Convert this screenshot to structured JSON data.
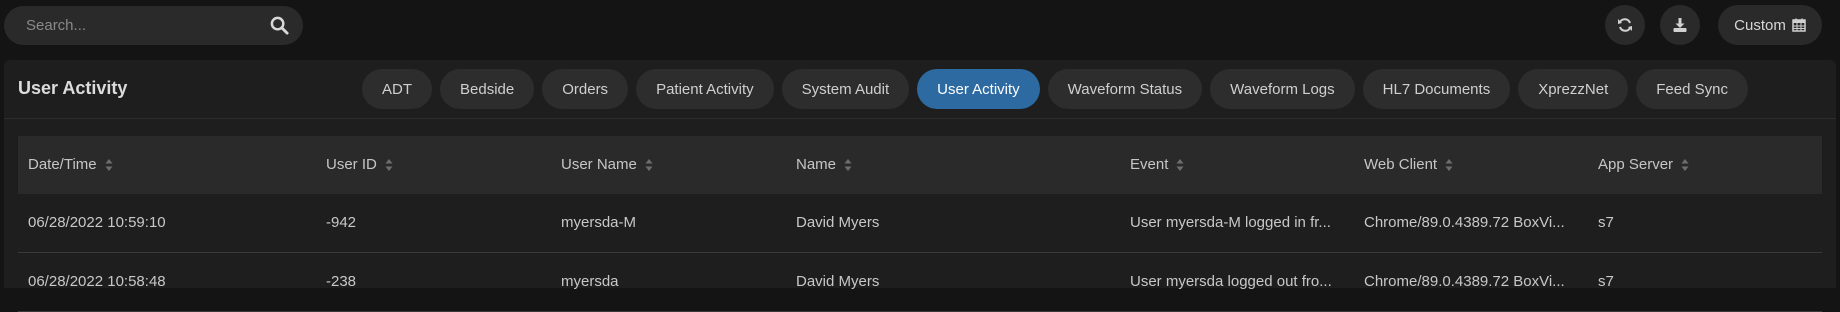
{
  "search": {
    "placeholder": "Search..."
  },
  "toolbar": {
    "custom_label": "Custom"
  },
  "panel": {
    "title": "User Activity"
  },
  "tabs": [
    {
      "label": "ADT",
      "active": false
    },
    {
      "label": "Bedside",
      "active": false
    },
    {
      "label": "Orders",
      "active": false
    },
    {
      "label": "Patient Activity",
      "active": false
    },
    {
      "label": "System Audit",
      "active": false
    },
    {
      "label": "User Activity",
      "active": true
    },
    {
      "label": "Waveform Status",
      "active": false
    },
    {
      "label": "Waveform Logs",
      "active": false
    },
    {
      "label": "HL7 Documents",
      "active": false
    },
    {
      "label": "XprezzNet",
      "active": false
    },
    {
      "label": "Feed Sync",
      "active": false
    }
  ],
  "table": {
    "columns": [
      "Date/Time",
      "User ID",
      "User Name",
      "Name",
      "Event",
      "Web Client",
      "App Server"
    ],
    "rows": [
      [
        "06/28/2022 10:59:10",
        "-942",
        "myersda-M",
        "David Myers",
        "User myersda-M logged in fr...",
        "Chrome/89.0.4389.72 BoxVi...",
        "s7"
      ],
      [
        "06/28/2022 10:58:48",
        "-238",
        "myersda",
        "David Myers",
        "User myersda logged out fro...",
        "Chrome/89.0.4389.72 BoxVi...",
        "s7"
      ]
    ]
  },
  "colors": {
    "accent": "#2c6aa1",
    "background": "#141414",
    "panel": "#1e1e1e"
  }
}
